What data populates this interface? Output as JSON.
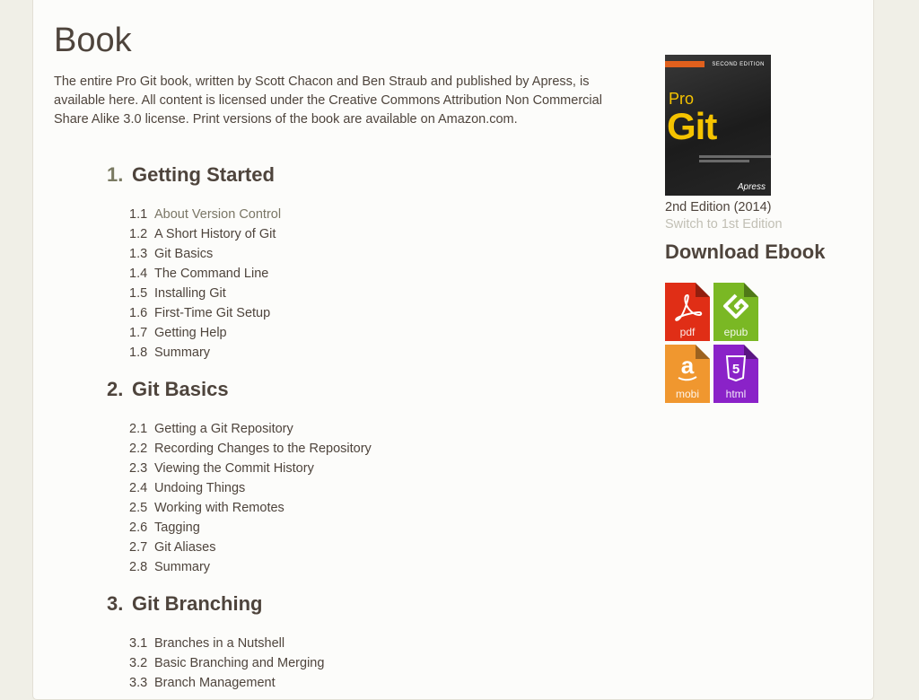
{
  "page": {
    "title": "Book",
    "intro": "The entire Pro Git book, written by Scott Chacon and Ben Straub and published by Apress, is available here. All content is licensed under the Creative Commons Attribution Non Commercial Share Alike 3.0 license. Print versions of the book are available on Amazon.com."
  },
  "toc": [
    {
      "num": "1.",
      "title": "Getting Started",
      "sections": [
        {
          "num": "1.1",
          "title": "About Version Control"
        },
        {
          "num": "1.2",
          "title": "A Short History of Git"
        },
        {
          "num": "1.3",
          "title": "Git Basics"
        },
        {
          "num": "1.4",
          "title": "The Command Line"
        },
        {
          "num": "1.5",
          "title": "Installing Git"
        },
        {
          "num": "1.6",
          "title": "First-Time Git Setup"
        },
        {
          "num": "1.7",
          "title": "Getting Help"
        },
        {
          "num": "1.8",
          "title": "Summary"
        }
      ]
    },
    {
      "num": "2.",
      "title": "Git Basics",
      "sections": [
        {
          "num": "2.1",
          "title": "Getting a Git Repository"
        },
        {
          "num": "2.2",
          "title": "Recording Changes to the Repository"
        },
        {
          "num": "2.3",
          "title": "Viewing the Commit History"
        },
        {
          "num": "2.4",
          "title": "Undoing Things"
        },
        {
          "num": "2.5",
          "title": "Working with Remotes"
        },
        {
          "num": "2.6",
          "title": "Tagging"
        },
        {
          "num": "2.7",
          "title": "Git Aliases"
        },
        {
          "num": "2.8",
          "title": "Summary"
        }
      ]
    },
    {
      "num": "3.",
      "title": "Git Branching",
      "sections": [
        {
          "num": "3.1",
          "title": "Branches in a Nutshell"
        },
        {
          "num": "3.2",
          "title": "Basic Branching and Merging"
        },
        {
          "num": "3.3",
          "title": "Branch Management"
        }
      ]
    }
  ],
  "sidebar": {
    "cover": {
      "pro": "Pro",
      "git": "Git",
      "edition_tag": "SECOND EDITION",
      "publisher": "Apress"
    },
    "edition": "2nd Edition (2014)",
    "switch_edition": "Switch to 1st Edition",
    "download_title": "Download Ebook",
    "ebooks": [
      {
        "label": "pdf",
        "icon": "acrobat-icon",
        "color": "#e02e16"
      },
      {
        "label": "epub",
        "icon": "epub-icon",
        "color": "#7ab824"
      },
      {
        "label": "mobi",
        "icon": "amazon-icon",
        "color": "#f0972f"
      },
      {
        "label": "html",
        "icon": "html5-icon",
        "color": "#8a22c8"
      }
    ]
  }
}
